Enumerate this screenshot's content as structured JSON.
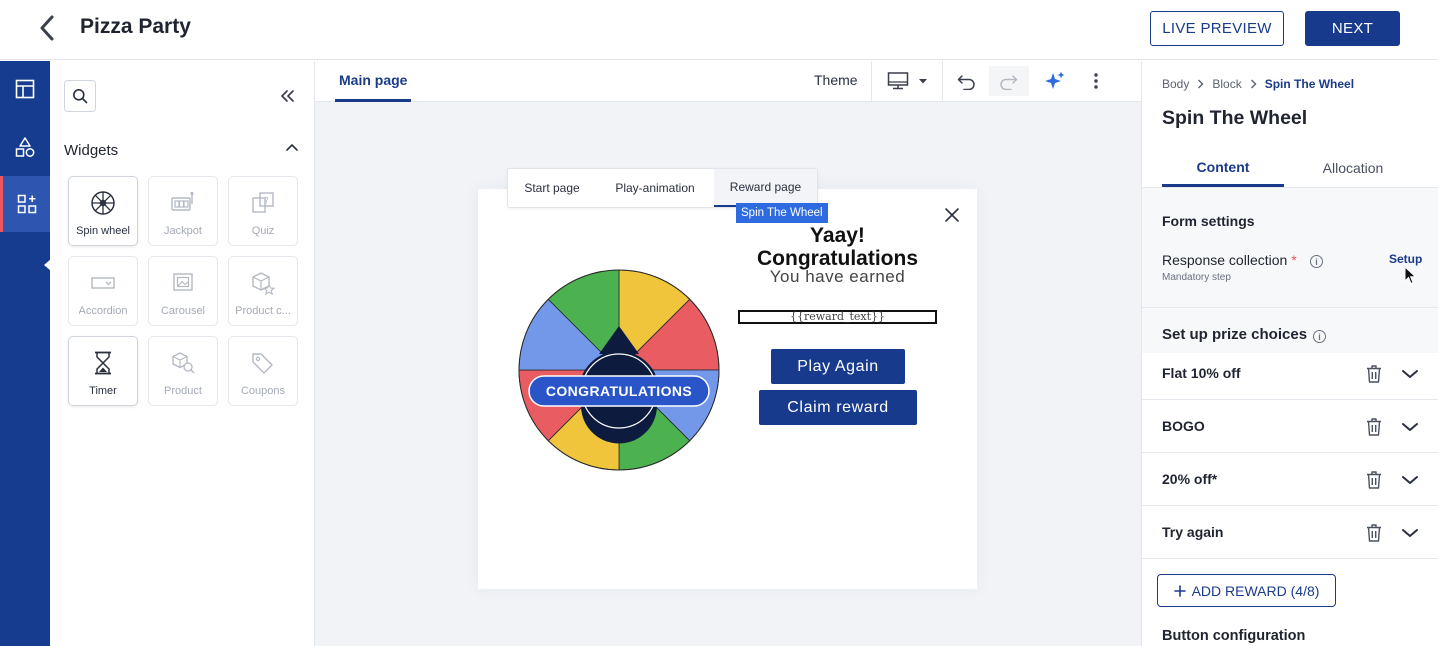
{
  "header": {
    "title": "Pizza Party",
    "live_preview_label": "LIVE PREVIEW",
    "next_label": "NEXT"
  },
  "rail": {
    "items": [
      {
        "icon": "layout-icon"
      },
      {
        "icon": "shapes-icon"
      },
      {
        "icon": "widgets-grid-icon",
        "active": true
      }
    ]
  },
  "widgets_panel": {
    "heading": "Widgets",
    "tiles": [
      {
        "label": "Spin wheel",
        "icon": "wheel-icon",
        "enabled": true
      },
      {
        "label": "Jackpot",
        "icon": "slot-machine-icon",
        "enabled": false
      },
      {
        "label": "Quiz",
        "icon": "quiz-icon",
        "enabled": false
      },
      {
        "label": "Accordion",
        "icon": "accordion-icon",
        "enabled": false
      },
      {
        "label": "Carousel",
        "icon": "carousel-icon",
        "enabled": false
      },
      {
        "label": "Product c...",
        "icon": "product-cube-icon",
        "enabled": false
      },
      {
        "label": "Timer",
        "icon": "hourglass-icon",
        "enabled": true
      },
      {
        "label": "Product",
        "icon": "product-search-icon",
        "enabled": false
      },
      {
        "label": "Coupons",
        "icon": "tag-icon",
        "enabled": false
      }
    ]
  },
  "canvas": {
    "main_tab": "Main page",
    "theme_label": "Theme",
    "page_tabs": [
      "Start page",
      "Play-animation",
      "Reward page"
    ],
    "active_page_tab": "Reward page",
    "block_badge": "Spin The Wheel",
    "wheel_label": "CONGRATULATIONS",
    "heading_line1": "Yaay!",
    "heading_line2": "Congratulations",
    "subheading": "You have earned",
    "reward_placeholder": "{{reward_text}}",
    "play_again_label": "Play Again",
    "claim_label": "Claim reward",
    "wheel_colors": [
      "#f0c53c",
      "#e85c62",
      "#7398ea",
      "#4cb24f",
      "#f0c53c",
      "#e85c62",
      "#7398ea",
      "#4cb24f"
    ]
  },
  "properties": {
    "breadcrumb": [
      "Body",
      "Block",
      "Spin The Wheel"
    ],
    "title": "Spin The Wheel",
    "tabs": [
      "Content",
      "Allocation"
    ],
    "active_tab": "Content",
    "form_settings_label": "Form settings",
    "response_collection_label": "Response collection",
    "required_mark": "*",
    "mandatory_note": "Mandatory step",
    "setup_label": "Setup",
    "prize_choices_label": "Set up prize choices",
    "prizes": [
      "Flat 10% off",
      "BOGO",
      "20% off*",
      "Try again"
    ],
    "add_reward_label": "ADD REWARD (4/8)",
    "button_config_label": "Button configuration"
  },
  "colors": {
    "brand_navy": "#173a8c",
    "accent_blue": "#2f6be0",
    "rail_active_marker": "#e9565e"
  }
}
